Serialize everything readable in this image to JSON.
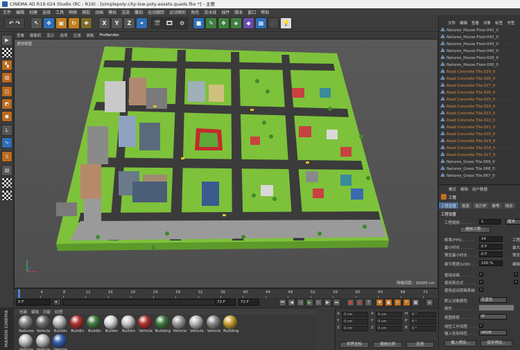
{
  "window": {
    "title": "CINEMA 4D R19.024 Studio (RC - R19) - [simplepoly-city-low-poly-assets.quads.fbx *] - 主要"
  },
  "menubar": [
    "文件",
    "编辑",
    "创建",
    "选择",
    "工具",
    "网格",
    "捕捉",
    "动画",
    "模拟",
    "渲染",
    "雕刻",
    "运动跟踪",
    "运动图形",
    "角色",
    "流水线",
    "插件",
    "脚本",
    "窗口",
    "帮助"
  ],
  "toolbar": {
    "undo": "↶",
    "redo": "↷",
    "x": "X",
    "y": "Y",
    "z": "Z"
  },
  "viewport": {
    "menu": [
      "查看",
      "摄像机",
      "显示",
      "选项",
      "过滤",
      "面板",
      "ProRender"
    ],
    "label": "透视视图",
    "grid_info": "网格间距 : 10000 cm"
  },
  "timeline": {
    "ticks": [
      "0",
      "4",
      "8",
      "12",
      "16",
      "20",
      "24",
      "28",
      "32",
      "36",
      "40",
      "44",
      "48",
      "52",
      "56",
      "60",
      "64",
      "68",
      "72"
    ],
    "current": "0 F",
    "start": "0 F",
    "end": "72 F",
    "end2": "72 F"
  },
  "materials": {
    "tabs": [
      "创建",
      "编辑",
      "功能",
      "纹理"
    ],
    "items": [
      {
        "label": "Natures",
        "color": "#8a8a8a"
      },
      {
        "label": "Vehicle",
        "color": "#6e6e6e"
      },
      {
        "label": "Buildin",
        "color": "#b8b8b8"
      },
      {
        "label": "Buildin",
        "color": "#b03030"
      },
      {
        "label": "Buildin",
        "color": "#3f7a3f"
      },
      {
        "label": "Buildin",
        "color": "#d8d8d8"
      },
      {
        "label": "Buildin",
        "color": "#c8c8c8"
      },
      {
        "label": "Vehicle",
        "color": "#b03030"
      },
      {
        "label": "Building",
        "color": "#3f7a3f"
      },
      {
        "label": "Vehicle",
        "color": "#9a9a9a"
      },
      {
        "label": "Vehicle",
        "color": "#b8b8b8"
      },
      {
        "label": "Vehicle",
        "color": "#8a8a8a"
      },
      {
        "label": "Building",
        "color": "#c8a030"
      },
      {
        "label": "Vehicle",
        "color": "#c0c0c0"
      },
      {
        "label": "Vehicle",
        "color": "#b8b8b8"
      },
      {
        "label": "Vehicle",
        "color": "#3060b0"
      }
    ]
  },
  "coords": {
    "rows": [
      {
        "axis": "X",
        "pos": "0 cm",
        "mid": "X",
        "size": "0 cm",
        "rot": "H",
        "rv": "0 °"
      },
      {
        "axis": "Y",
        "pos": "0 cm",
        "mid": "Y",
        "size": "0 cm",
        "rot": "P",
        "rv": "0 °"
      },
      {
        "axis": "Z",
        "pos": "0 cm",
        "mid": "Z",
        "size": "0 cm",
        "rot": "B",
        "rv": "0 °"
      }
    ],
    "mode": "世界坐标",
    "scale": "缩放比例",
    "apply": "应用"
  },
  "objects": {
    "menu": [
      "文件",
      "编辑",
      "查看",
      "对象",
      "标签",
      "书签"
    ],
    "items": [
      {
        "label": "Natures_House Floor.041_0",
        "type": "nature"
      },
      {
        "label": "Natures_House Floor.042_0",
        "type": "nature"
      },
      {
        "label": "Natures_House Floor.043_0",
        "type": "nature"
      },
      {
        "label": "Natures_House Floor.040_0",
        "type": "nature"
      },
      {
        "label": "Natures_House Floor.026_0",
        "type": "nature"
      },
      {
        "label": "Natures_House Floor.000_0",
        "type": "nature"
      },
      {
        "label": "Road Concrete Tile.029_0",
        "type": "road"
      },
      {
        "label": "Road Concrete Tile.028_0",
        "type": "road"
      },
      {
        "label": "Road Concrete Tile.027_0",
        "type": "road"
      },
      {
        "label": "Road Concrete Tile.026_0",
        "type": "road"
      },
      {
        "label": "Road Concrete Tile.025_0",
        "type": "road"
      },
      {
        "label": "Road Concrete Tile.024_0",
        "type": "road"
      },
      {
        "label": "Road Concrete Tile.023_0",
        "type": "road"
      },
      {
        "label": "Road Concrete Tile.022_0",
        "type": "road"
      },
      {
        "label": "Road Concrete Tile.021_0",
        "type": "road"
      },
      {
        "label": "Road Concrete Tile.020_0",
        "type": "road"
      },
      {
        "label": "Road Concrete Tile.019_0",
        "type": "road"
      },
      {
        "label": "Road Concrete Tile.018_0",
        "type": "road"
      },
      {
        "label": "Road Concrete Tile.017_0",
        "type": "road"
      },
      {
        "label": "Natures_Grass Tile.069_0",
        "type": "nature"
      },
      {
        "label": "Natures_Grass Tile.068_0",
        "type": "nature"
      },
      {
        "label": "Natures_Grass Tile.067_0",
        "type": "nature"
      }
    ]
  },
  "attributes": {
    "menu": [
      "模式",
      "编辑",
      "用户数据"
    ],
    "title": "工程",
    "tabs": [
      "工程设置",
      "信息",
      "动力学",
      "参考",
      "待办"
    ],
    "section": "工程设置",
    "scale_label": "工程缩放 . . . . . .",
    "scale_value": "1",
    "scale_unit": "厘米",
    "scale_btn": "缩放工程...",
    "fps_label": "帧率(FPS) . . . . .",
    "fps_value": "24",
    "fps_right": "工程",
    "min_label": "最小时长 . . . . . .",
    "min_value": "0 F",
    "min_right": "最大",
    "preview_min_label": "预览最小时长 . . . .",
    "preview_min_value": "0 F",
    "preview_min_right": "预览",
    "lod_label": "细节程度(LOD) . . .",
    "lod_value": "100 %",
    "lod_right": "编辑",
    "anim_label": "使用动画 . . . . . .",
    "expr_label": "使用表达式 . . . . .",
    "gen_label": "使用生成器 . . . . .",
    "deform_label": "使用变形器 . . . . .",
    "motion_label": "使用运动剪辑系统 . .",
    "defobj_label": "默认对象颜色",
    "defobj_value": "灰蓝色",
    "color_label": "颜色 . . . . . . . .",
    "view_label": "视图修剪 . . . . . .",
    "view_value": "中",
    "linear_label": "线性工作流程 . . . .",
    "input_label": "输入色彩特性 . . . .",
    "input_value": "sRGB",
    "btn1": "载入预设...",
    "btn2": "保存预设..."
  }
}
